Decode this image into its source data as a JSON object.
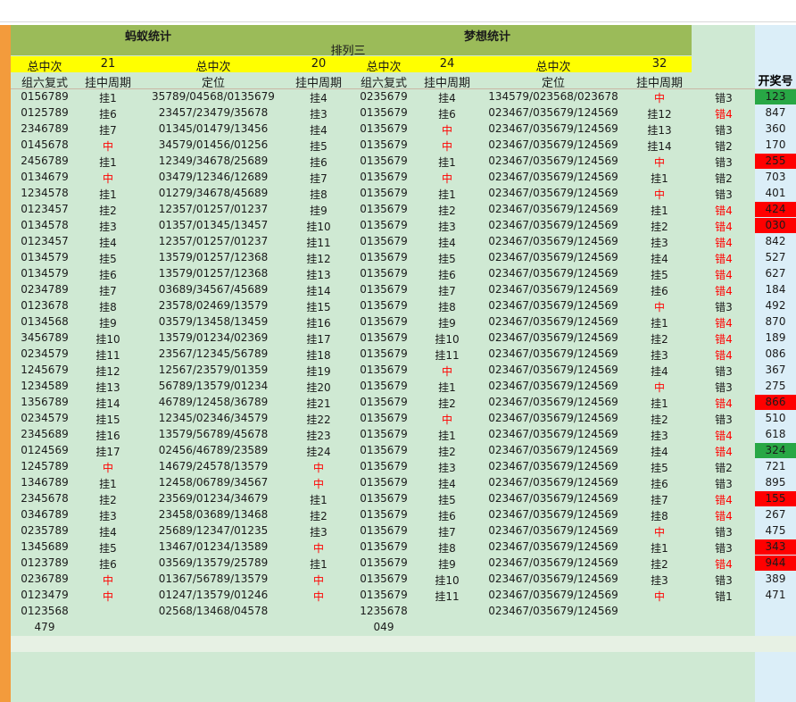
{
  "header": {
    "ant_title": "蚂蚁统计",
    "dream_title": "梦想统计",
    "subtitle": "排列三",
    "total_label_1": "总中次",
    "total_value_1": "21",
    "total_label_2": "总中次",
    "total_value_2": "20",
    "total_label_3": "总中次",
    "total_value_3": "24",
    "total_label_4": "总中次",
    "total_value_4": "32",
    "col_zu6_a": "组六复式",
    "col_cycle_a": "挂中周期",
    "col_pos_a": "定位",
    "col_cycle_b": "挂中周期",
    "col_zu6_b": "组六复式",
    "col_cycle_c": "挂中周期",
    "col_pos_b": "定位",
    "col_cycle_d": "挂中周期",
    "col_kaijiang": "开奖号"
  },
  "rows": [
    [
      "0156789",
      "挂1",
      "35789/04568/0135679",
      "挂4",
      "0235679",
      "挂4",
      "134579/023568/023678",
      "中",
      "错3",
      "123"
    ],
    [
      "0125789",
      "挂6",
      "23457/23479/35678",
      "挂3",
      "0135679",
      "挂6",
      "023467/035679/124569",
      "挂12",
      "错4",
      "847"
    ],
    [
      "2346789",
      "挂7",
      "01345/01479/13456",
      "挂4",
      "0135679",
      "中",
      "023467/035679/124569",
      "挂13",
      "错3",
      "360"
    ],
    [
      "0145678",
      "中",
      "34579/01456/01256",
      "挂5",
      "0135679",
      "中",
      "023467/035679/124569",
      "挂14",
      "错2",
      "170"
    ],
    [
      "2456789",
      "挂1",
      "12349/34678/25689",
      "挂6",
      "0135679",
      "挂1",
      "023467/035679/124569",
      "中",
      "错3",
      "255"
    ],
    [
      "0134679",
      "中",
      "03479/12346/12689",
      "挂7",
      "0135679",
      "中",
      "023467/035679/124569",
      "挂1",
      "错2",
      "703"
    ],
    [
      "1234578",
      "挂1",
      "01279/34678/45689",
      "挂8",
      "0135679",
      "挂1",
      "023467/035679/124569",
      "中",
      "错3",
      "401"
    ],
    [
      "0123457",
      "挂2",
      "12357/01257/01237",
      "挂9",
      "0135679",
      "挂2",
      "023467/035679/124569",
      "挂1",
      "错4",
      "424"
    ],
    [
      "0134578",
      "挂3",
      "01357/01345/13457",
      "挂10",
      "0135679",
      "挂3",
      "023467/035679/124569",
      "挂2",
      "错4",
      "030"
    ],
    [
      "0123457",
      "挂4",
      "12357/01257/01237",
      "挂11",
      "0135679",
      "挂4",
      "023467/035679/124569",
      "挂3",
      "错4",
      "842"
    ],
    [
      "0134579",
      "挂5",
      "13579/01257/12368",
      "挂12",
      "0135679",
      "挂5",
      "023467/035679/124569",
      "挂4",
      "错4",
      "527"
    ],
    [
      "0134579",
      "挂6",
      "13579/01257/12368",
      "挂13",
      "0135679",
      "挂6",
      "023467/035679/124569",
      "挂5",
      "错4",
      "627"
    ],
    [
      "0234789",
      "挂7",
      "03689/34567/45689",
      "挂14",
      "0135679",
      "挂7",
      "023467/035679/124569",
      "挂6",
      "错4",
      "184"
    ],
    [
      "0123678",
      "挂8",
      "23578/02469/13579",
      "挂15",
      "0135679",
      "挂8",
      "023467/035679/124569",
      "中",
      "错3",
      "492"
    ],
    [
      "0134568",
      "挂9",
      "03579/13458/13459",
      "挂16",
      "0135679",
      "挂9",
      "023467/035679/124569",
      "挂1",
      "错4",
      "870"
    ],
    [
      "3456789",
      "挂10",
      "13579/01234/02369",
      "挂17",
      "0135679",
      "挂10",
      "023467/035679/124569",
      "挂2",
      "错4",
      "189"
    ],
    [
      "0234579",
      "挂11",
      "23567/12345/56789",
      "挂18",
      "0135679",
      "挂11",
      "023467/035679/124569",
      "挂3",
      "错4",
      "086"
    ],
    [
      "1245679",
      "挂12",
      "12567/23579/01359",
      "挂19",
      "0135679",
      "中",
      "023467/035679/124569",
      "挂4",
      "错3",
      "367"
    ],
    [
      "1234589",
      "挂13",
      "56789/13579/01234",
      "挂20",
      "0135679",
      "挂1",
      "023467/035679/124569",
      "中",
      "错3",
      "275"
    ],
    [
      "1356789",
      "挂14",
      "46789/12458/36789",
      "挂21",
      "0135679",
      "挂2",
      "023467/035679/124569",
      "挂1",
      "错4",
      "866"
    ],
    [
      "0234579",
      "挂15",
      "12345/02346/34579",
      "挂22",
      "0135679",
      "中",
      "023467/035679/124569",
      "挂2",
      "错3",
      "510"
    ],
    [
      "2345689",
      "挂16",
      "13579/56789/45678",
      "挂23",
      "0135679",
      "挂1",
      "023467/035679/124569",
      "挂3",
      "错4",
      "618"
    ],
    [
      "0124569",
      "挂17",
      "02456/46789/23589",
      "挂24",
      "0135679",
      "挂2",
      "023467/035679/124569",
      "挂4",
      "错4",
      "324"
    ],
    [
      "1245789",
      "中",
      "14679/24578/13579",
      "中",
      "0135679",
      "挂3",
      "023467/035679/124569",
      "挂5",
      "错2",
      "721"
    ],
    [
      "1346789",
      "挂1",
      "12458/06789/34567",
      "中",
      "0135679",
      "挂4",
      "023467/035679/124569",
      "挂6",
      "错3",
      "895"
    ],
    [
      "2345678",
      "挂2",
      "23569/01234/34679",
      "挂1",
      "0135679",
      "挂5",
      "023467/035679/124569",
      "挂7",
      "错4",
      "155"
    ],
    [
      "0346789",
      "挂3",
      "23458/03689/13468",
      "挂2",
      "0135679",
      "挂6",
      "023467/035679/124569",
      "挂8",
      "错4",
      "267"
    ],
    [
      "0235789",
      "挂4",
      "25689/12347/01235",
      "挂3",
      "0135679",
      "挂7",
      "023467/035679/124569",
      "中",
      "错3",
      "475"
    ],
    [
      "1345689",
      "挂5",
      "13467/01234/13589",
      "中",
      "0135679",
      "挂8",
      "023467/035679/124569",
      "挂1",
      "错3",
      "343"
    ],
    [
      "0123789",
      "挂6",
      "03569/13579/25789",
      "挂1",
      "0135679",
      "挂9",
      "023467/035679/124569",
      "挂2",
      "错4",
      "944"
    ],
    [
      "0236789",
      "中",
      "01367/56789/13579",
      "中",
      "0135679",
      "挂10",
      "023467/035679/124569",
      "挂3",
      "错3",
      "389"
    ],
    [
      "0123479",
      "中",
      "01247/13579/01246",
      "中",
      "0135679",
      "挂11",
      "023467/035679/124569",
      "中",
      "错1",
      "471"
    ],
    [
      "0123568",
      "",
      "02568/13468/04578",
      "",
      "1235678",
      "",
      "023467/035679/124569",
      "",
      "",
      ""
    ],
    [
      "479",
      "",
      "",
      "",
      "049",
      "",
      "",
      "",
      "",
      ""
    ]
  ],
  "highlights": {
    "red_bg": [
      "255",
      "424",
      "030",
      "866",
      "155",
      "343",
      "944"
    ],
    "green_bg": [
      "123",
      "324"
    ],
    "red_text": "#ff0000",
    "green_bg_color": "#28a745",
    "red_bg_color": "#ff0000"
  }
}
